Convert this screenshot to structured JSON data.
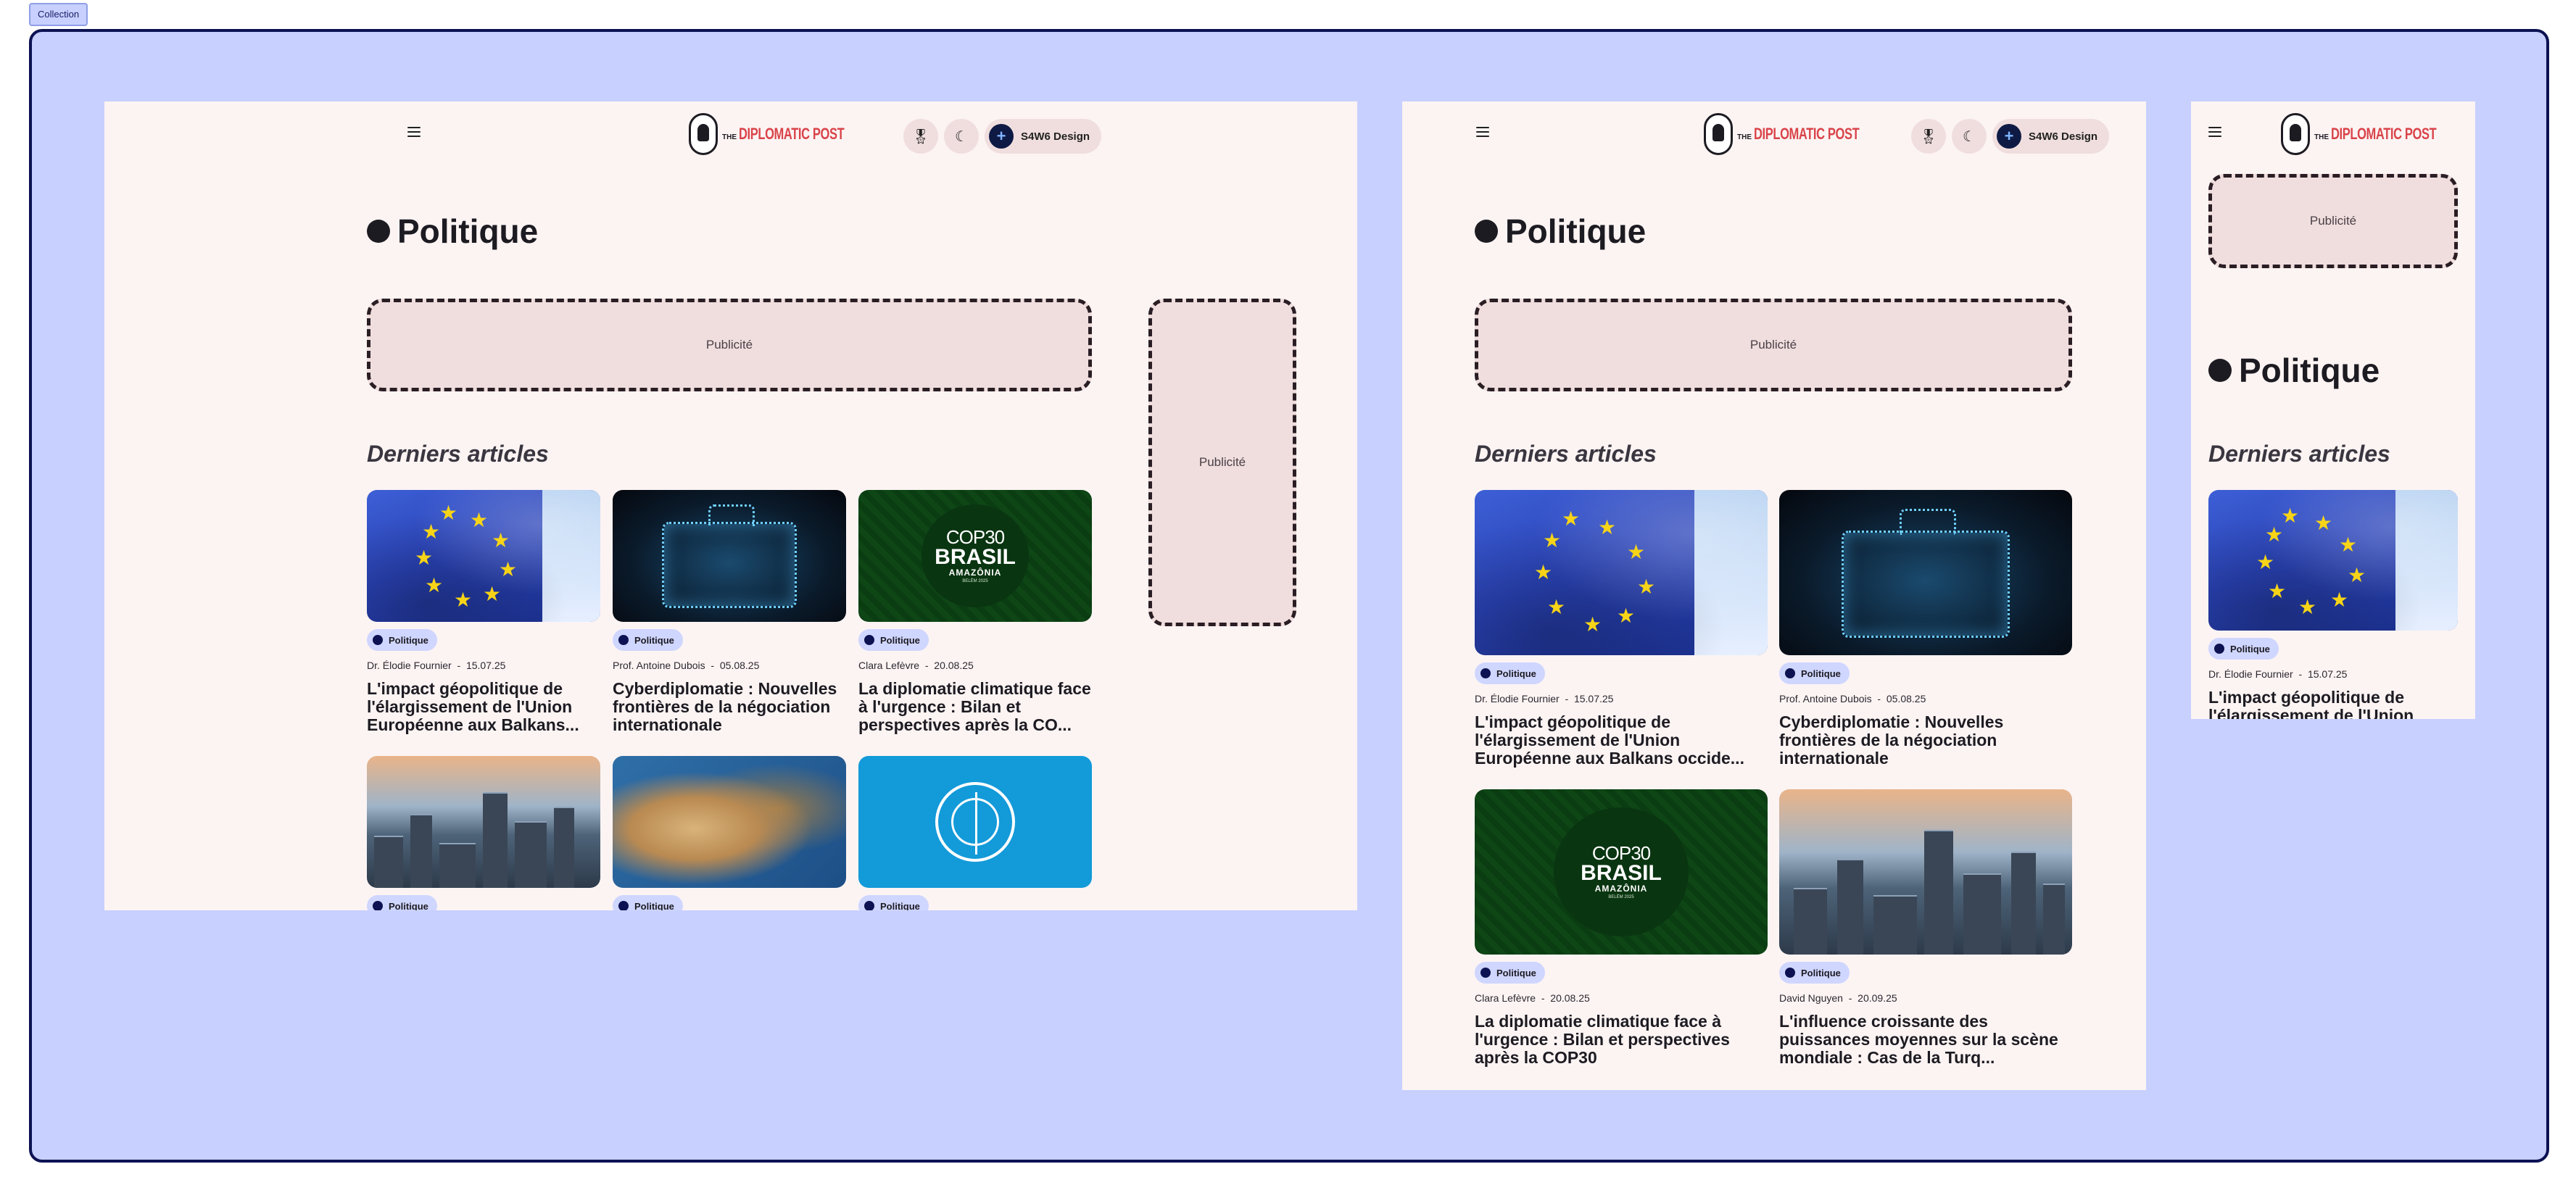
{
  "collection_label": "Collection",
  "header": {
    "brand_prefix": "THE",
    "brand_name": "DIPLOMATIC POST",
    "workspace_label": "S4W6 Design",
    "menu_icon": "hamburger-menu-icon",
    "award_icon": "medal-icon",
    "theme_icon": "moon-icon",
    "workspace_icon": "plus-icon"
  },
  "page": {
    "title": "Politique",
    "ad_label": "Publicité",
    "section_title": "Derniers articles"
  },
  "colors": {
    "canvas": "#c7d0ff",
    "canvas_border": "#0c1252",
    "page_bg": "#fcf4f3",
    "accent_red": "#d9444a",
    "badge_bg": "#cfd6ff"
  },
  "articles": [
    {
      "category": "Politique",
      "author": "Dr. Élodie Fournier",
      "date": "15.07.25",
      "title_desktop": "L'impact géopolitique de l'élargissement de l'Union Européenne aux Balkans...",
      "title_tablet": "L'impact géopolitique de l'élargissement de l'Union Européenne aux Balkans occide...",
      "title_mobile": "L'impact géopolitique de l'élargissement de l'Union",
      "image": "eu-flag"
    },
    {
      "category": "Politique",
      "author": "Prof. Antoine Dubois",
      "date": "05.08.25",
      "title_desktop": "Cyberdiplomatie : Nouvelles frontières de la négociation internationale",
      "title_tablet": "Cyberdiplomatie : Nouvelles frontières de la négociation internationale",
      "image": "digital-briefcase"
    },
    {
      "category": "Politique",
      "author": "Clara Lefèvre",
      "date": "20.08.25",
      "title_desktop": "La diplomatie climatique face à l'urgence : Bilan et perspectives après la CO...",
      "title_tablet": "La diplomatie climatique face à l'urgence : Bilan et perspectives après la COP30",
      "image": "cop30-brasil",
      "cop_a": "COP30",
      "cop_b": "BRASIL",
      "cop_c": "AMAZÔNIA",
      "cop_d": "BELÉM 2025"
    },
    {
      "category": "Politique",
      "author": "David Nguyen",
      "date": "20.09.25",
      "title_tablet": "L'influence croissante des puissances moyennes sur la scène mondiale : Cas de la Turq...",
      "image": "city-skyline"
    },
    {
      "category": "Politique",
      "image": "middle-east-map"
    },
    {
      "category": "Politique",
      "image": "un-emblem"
    }
  ]
}
